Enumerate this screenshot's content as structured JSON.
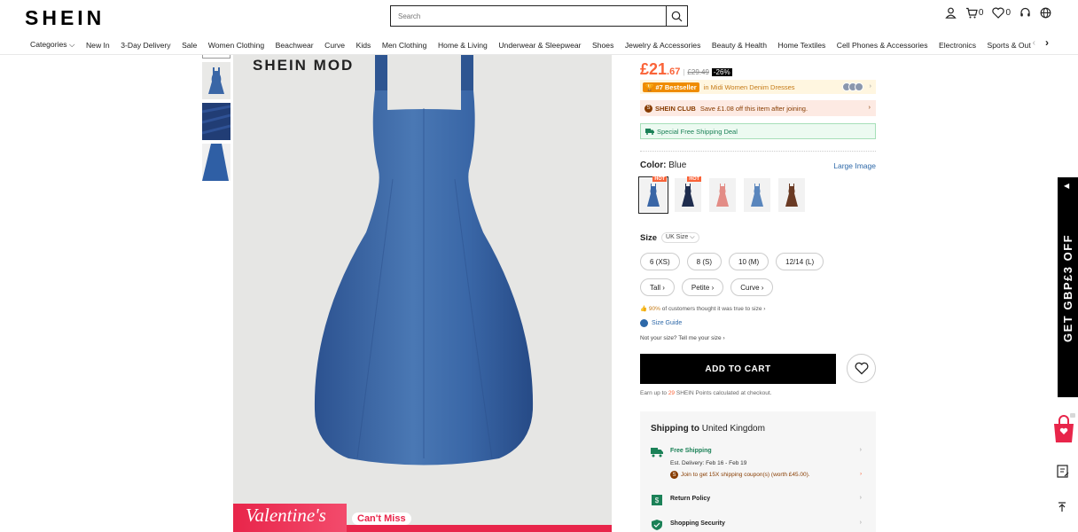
{
  "header": {
    "logo": "SHEIN",
    "search_placeholder": "Search",
    "cart_count": "0",
    "wishlist_count": "0"
  },
  "nav": {
    "items": [
      "Categories ⌵",
      "New In",
      "3-Day Delivery",
      "Sale",
      "Women Clothing",
      "Beachwear",
      "Curve",
      "Kids",
      "Men Clothing",
      "Home & Living",
      "Underwear & Sleepwear",
      "Shoes",
      "Jewelry & Accessories",
      "Beauty & Health",
      "Home Textiles",
      "Cell Phones & Accessories",
      "Electronics",
      "Sports & Out"
    ]
  },
  "gallery": {
    "brand_mark": "SHEIN MOD",
    "banner_title": "Valentine's",
    "banner_cta": "Can't Miss"
  },
  "product": {
    "price_main": "£21",
    "price_cents": ".67",
    "price_sep": "|",
    "price_old": "£29.49",
    "discount": "-26%",
    "bestseller_tag": "#7 Bestseller",
    "bestseller_cat": "in Midi Women Denim Dresses",
    "club_label": "SHEIN CLUB",
    "club_text": "Save £1.08 off this item after joining.",
    "ship_deal": "Special Free Shipping Deal",
    "color_label": "Color:",
    "color_value": "Blue",
    "large_image": "Large Image",
    "swatches": [
      {
        "color": "#3a66a6",
        "hot": "HOT"
      },
      {
        "color": "#1f2d4e",
        "hot": "HOT"
      },
      {
        "color": "#e38c86",
        "hot": ""
      },
      {
        "color": "#5a86bd",
        "hot": ""
      },
      {
        "color": "#6a3a24",
        "hot": ""
      }
    ],
    "size_label": "Size",
    "size_region": "UK Size ⌵",
    "sizes": [
      "6 (XS)",
      "8 (S)",
      "10 (M)",
      "12/14 (L)"
    ],
    "size_groups": [
      "Tall ›",
      "Petite ›",
      "Curve ›"
    ],
    "fit_pct": "90%",
    "fit_text": "of customers thought it was true to size ›",
    "size_guide": "Size Guide",
    "not_your_size": "Not your size? Tell me your size  ›",
    "add_to_cart": "ADD TO CART",
    "points_pre": "Earn up to",
    "points_num": "29",
    "points_post": "SHEIN Points calculated at checkout."
  },
  "shipping": {
    "title_bold": "Shipping to",
    "title_dest": "United Kingdom",
    "free_label": "Free Shipping",
    "est": "Est. Delivery: Feb 16 - Feb 19",
    "join": "Join to get 15X shipping coupon(s) (worth £45.00).",
    "return": "Return Policy",
    "security": "Shopping Security"
  },
  "side": {
    "promo": "GET GBP£3 OFF"
  },
  "colors": {
    "accent": "#fa6338",
    "brand_black": "#000000",
    "link_blue": "#2d68a8",
    "success_green": "#1b8157"
  }
}
